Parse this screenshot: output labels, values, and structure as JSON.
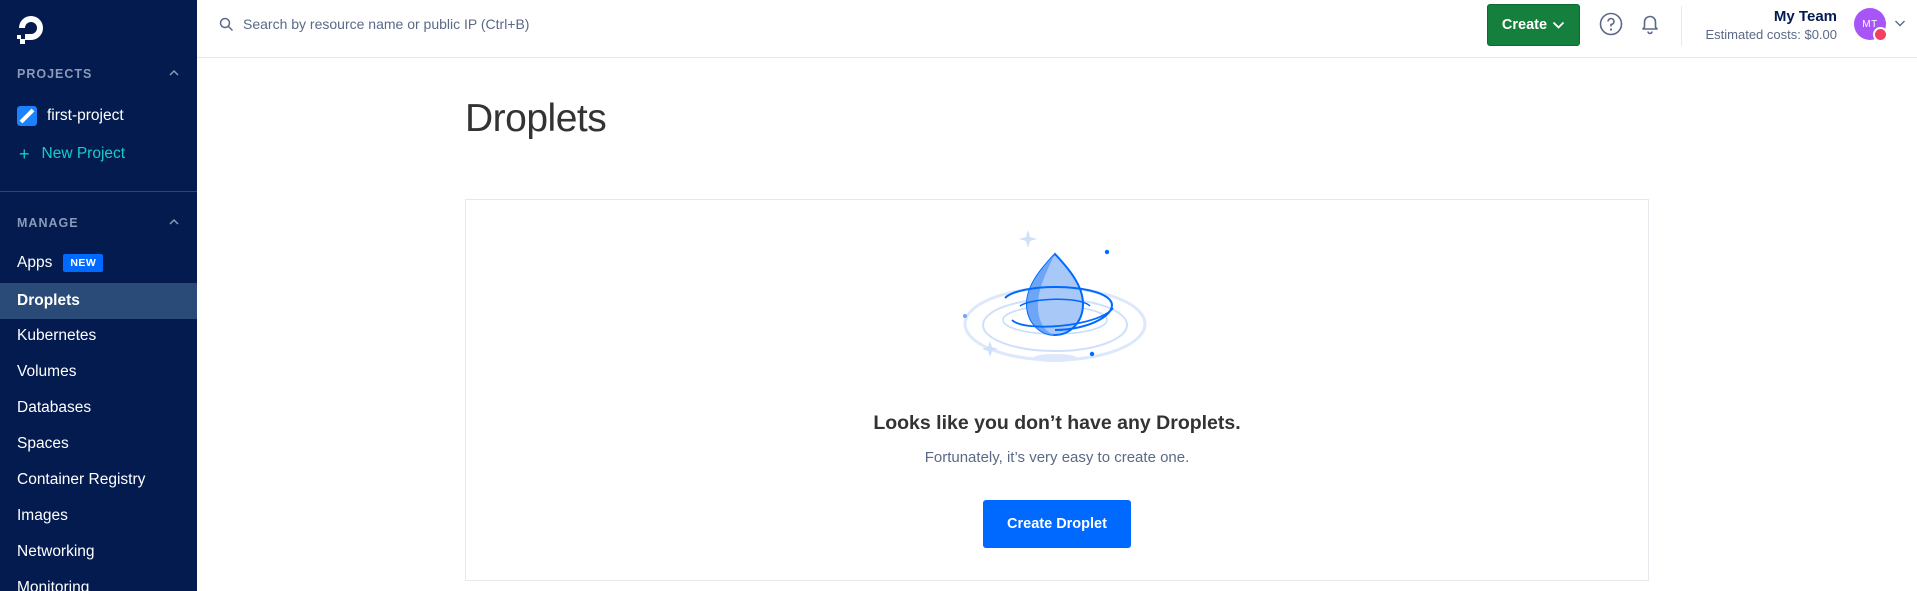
{
  "sidebar": {
    "projects_heading": "PROJECTS",
    "projects": [
      {
        "label": "first-project"
      }
    ],
    "new_project_label": "New Project",
    "manage_heading": "MANAGE",
    "nav": [
      {
        "label": "Apps",
        "badge": "NEW"
      },
      {
        "label": "Droplets"
      },
      {
        "label": "Kubernetes"
      },
      {
        "label": "Volumes"
      },
      {
        "label": "Databases"
      },
      {
        "label": "Spaces"
      },
      {
        "label": "Container Registry"
      },
      {
        "label": "Images"
      },
      {
        "label": "Networking"
      },
      {
        "label": "Monitoring"
      }
    ],
    "active": "Droplets"
  },
  "topbar": {
    "search_placeholder": "Search by resource name or public IP (Ctrl+B)",
    "create_label": "Create",
    "team_name": "My Team",
    "estimated_costs": "Estimated costs: $0.00",
    "avatar_initials": "MT"
  },
  "main": {
    "title": "Droplets",
    "empty_title": "Looks like you don’t have any Droplets.",
    "empty_subtitle": "Fortunately, it’s very easy to create one.",
    "cta_label": "Create Droplet"
  },
  "colors": {
    "sidebar_bg": "#031b4e",
    "accent_blue": "#0069ff",
    "create_green": "#15803d",
    "new_project_teal": "#15cdcb"
  }
}
